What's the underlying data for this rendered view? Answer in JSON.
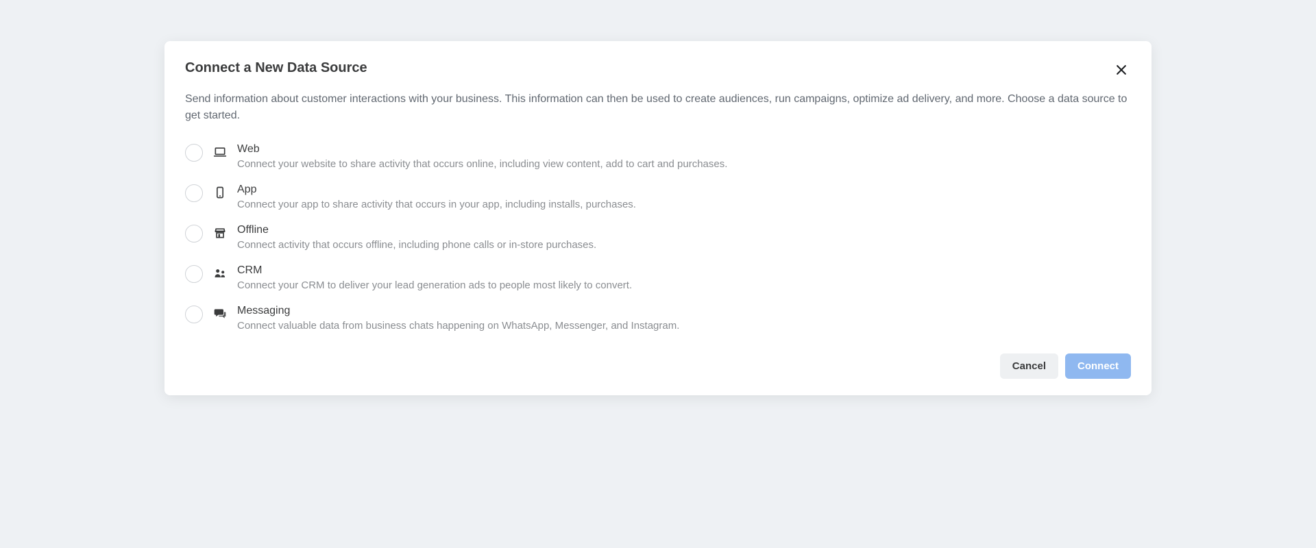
{
  "modal": {
    "title": "Connect a New Data Source",
    "subtitle": "Send information about customer interactions with your business. This information can then be used to create audiences, run campaigns, optimize ad delivery, and more. Choose a data source to get started.",
    "options": [
      {
        "icon": "laptop-icon",
        "title": "Web",
        "desc": "Connect your website to share activity that occurs online, including view content, add to cart and purchases."
      },
      {
        "icon": "phone-icon",
        "title": "App",
        "desc": "Connect your app to share activity that occurs in your app, including installs, purchases."
      },
      {
        "icon": "store-icon",
        "title": "Offline",
        "desc": "Connect activity that occurs offline, including phone calls or in-store purchases."
      },
      {
        "icon": "people-icon",
        "title": "CRM",
        "desc": "Connect your CRM to deliver your lead generation ads to people most likely to convert."
      },
      {
        "icon": "chat-icon",
        "title": "Messaging",
        "desc": "Connect valuable data from business chats happening on WhatsApp, Messenger, and Instagram."
      }
    ],
    "footer": {
      "cancel": "Cancel",
      "connect": "Connect"
    }
  }
}
